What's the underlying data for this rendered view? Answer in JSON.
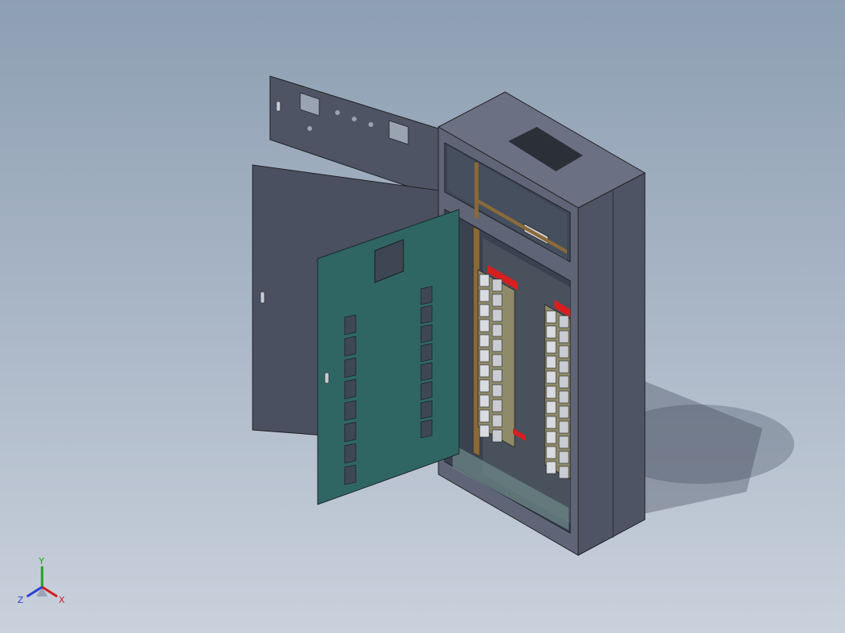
{
  "model": {
    "type": "electrical-distribution-cabinet",
    "doors_open": true,
    "colors": {
      "background_top": "#8d9fb3",
      "background_bottom": "#c9d1dc",
      "cabinet_body": "#5f6576",
      "inner_door": "#2f6663",
      "din_rail": "#8a6a3a",
      "breaker_accent": "#d61f1f"
    }
  },
  "triad": {
    "x_label": "X",
    "y_label": "Y",
    "z_label": "Z",
    "x_color": "#d01c1c",
    "y_color": "#1fa01f",
    "z_color": "#2a3fcf"
  }
}
